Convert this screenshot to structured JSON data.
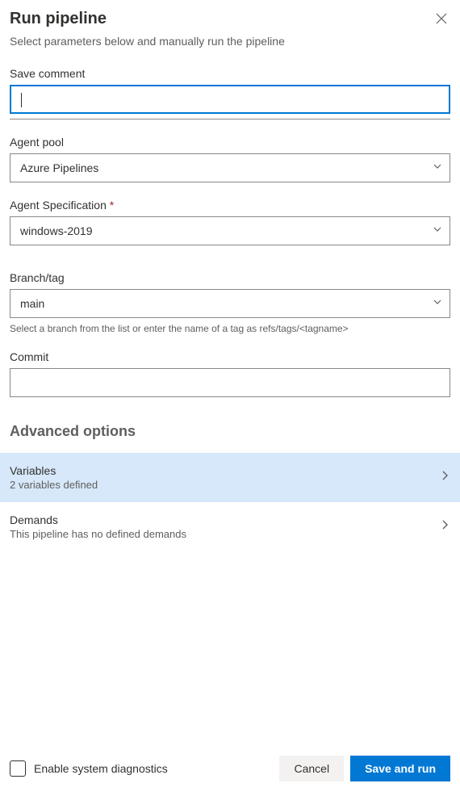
{
  "header": {
    "title": "Run pipeline",
    "subtitle": "Select parameters below and manually run the pipeline"
  },
  "fields": {
    "saveComment": {
      "label": "Save comment",
      "value": ""
    },
    "agentPool": {
      "label": "Agent pool",
      "value": "Azure Pipelines"
    },
    "agentSpecification": {
      "label": "Agent Specification",
      "required": "*",
      "value": "windows-2019"
    },
    "branchTag": {
      "label": "Branch/tag",
      "value": "main",
      "help": "Select a branch from the list or enter the name of a tag as refs/tags/<tagname>"
    },
    "commit": {
      "label": "Commit",
      "value": ""
    }
  },
  "advanced": {
    "heading": "Advanced options",
    "variables": {
      "title": "Variables",
      "subtitle": "2 variables defined"
    },
    "demands": {
      "title": "Demands",
      "subtitle": "This pipeline has no defined demands"
    }
  },
  "footer": {
    "diagnostics": "Enable system diagnostics",
    "cancel": "Cancel",
    "saveAndRun": "Save and run"
  }
}
